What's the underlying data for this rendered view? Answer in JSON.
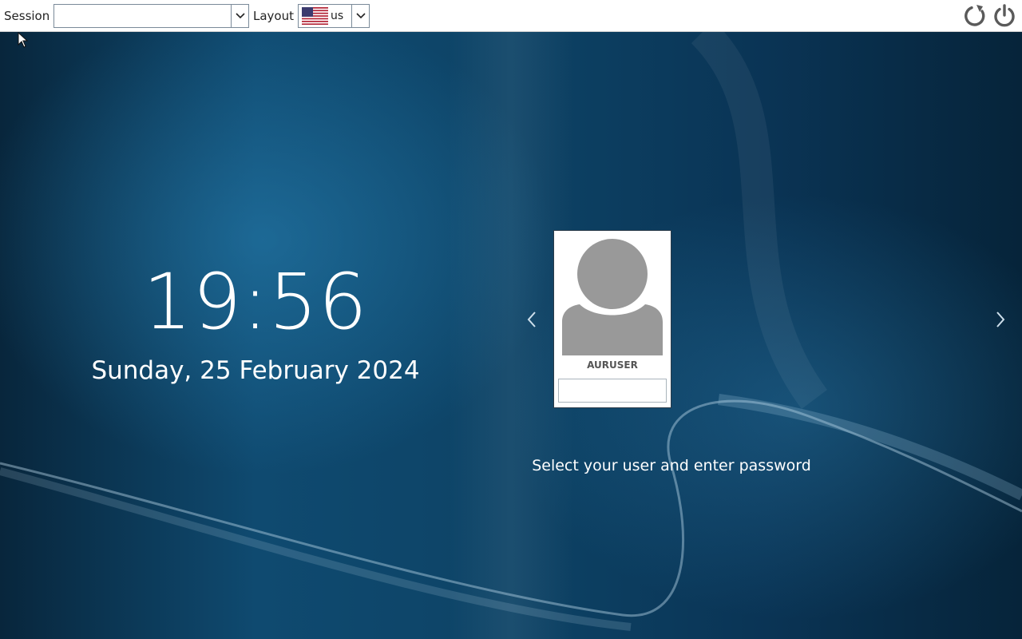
{
  "topbar": {
    "session_label": "Session",
    "session_value": "",
    "layout_label": "Layout",
    "layout_value": "us",
    "layout_flag": "us-flag-icon",
    "restart_icon": "restart-icon",
    "shutdown_icon": "power-icon"
  },
  "clock": {
    "time": "19:56",
    "date": "Sunday, 25 February 2024"
  },
  "user_card": {
    "username": "AURUSER",
    "password_value": "",
    "avatar_icon": "user-avatar-icon"
  },
  "nav": {
    "prev_icon": "chevron-left-icon",
    "next_icon": "chevron-right-icon"
  },
  "hint": "Select your user and enter password",
  "colors": {
    "topbar_bg": "#ffffff",
    "wallpaper_base": "#0d4366",
    "avatar_gray": "#999999",
    "text_light": "#ffffff"
  }
}
